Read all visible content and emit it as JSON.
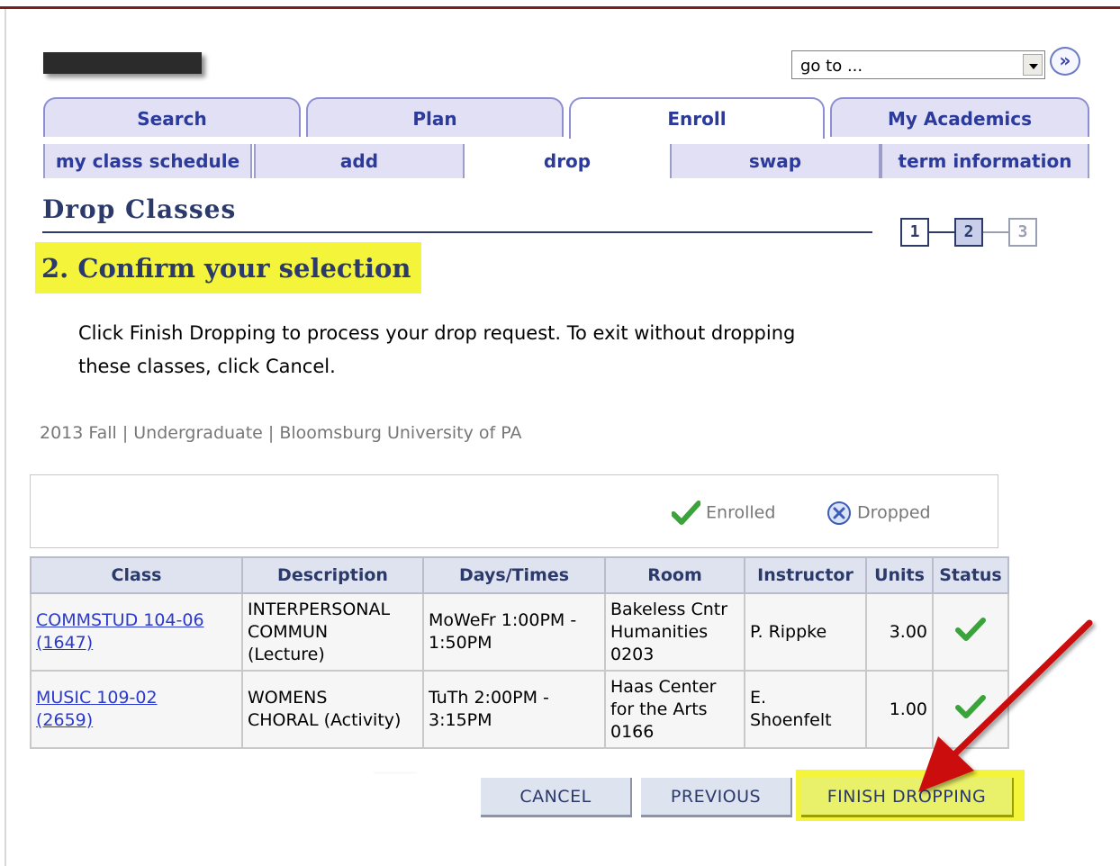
{
  "header": {
    "goto_value": "go to ..."
  },
  "tabs": [
    {
      "label": "Search"
    },
    {
      "label": "Plan"
    },
    {
      "label": "Enroll"
    },
    {
      "label": "My Academics"
    }
  ],
  "subtabs": [
    {
      "label": "my class schedule"
    },
    {
      "label": "add"
    },
    {
      "label": "drop"
    },
    {
      "label": "swap"
    },
    {
      "label": "term information"
    }
  ],
  "page": {
    "title": "Drop Classes",
    "subtitle": "2.  Confirm your selection",
    "instructions_line1": "Click Finish Dropping to process your drop request. To exit without dropping",
    "instructions_line2": "these classes, click Cancel.",
    "term_info": "2013 Fall | Undergraduate | Bloomsburg University of PA"
  },
  "stepper": {
    "steps": [
      "1",
      "2",
      "3"
    ],
    "current": 2
  },
  "legend": {
    "enrolled": "Enrolled",
    "dropped": "Dropped"
  },
  "table": {
    "headers": [
      "Class",
      "Description",
      "Days/Times",
      "Room",
      "Instructor",
      "Units",
      "Status"
    ],
    "rows": [
      {
        "class_line1": "COMMSTUD 104-06",
        "class_line2": "(1647)",
        "desc_line1": "INTERPERSONAL",
        "desc_line2": "COMMUN",
        "desc_line3": "(Lecture)",
        "days_line1": "MoWeFr 1:00PM -",
        "days_line2": "1:50PM",
        "room_line1": "Bakeless Cntr",
        "room_line2": "Humanities",
        "room_line3": "0203",
        "instructor_line1": "P. Rippke",
        "instructor_line2": "",
        "units": "3.00",
        "status": "enrolled"
      },
      {
        "class_line1": "MUSIC 109-02",
        "class_line2": "(2659)",
        "desc_line1": "WOMENS",
        "desc_line2": "CHORAL (Activity)",
        "desc_line3": "",
        "days_line1": "TuTh 2:00PM -",
        "days_line2": "3:15PM",
        "room_line1": "Haas Center",
        "room_line2": "for the Arts",
        "room_line3": "0166",
        "instructor_line1": "E.",
        "instructor_line2": "Shoenfelt",
        "units": "1.00",
        "status": "enrolled"
      }
    ]
  },
  "buttons": {
    "cancel": "CANCEL",
    "previous": "PREVIOUS",
    "finish": "FINISH DROPPING"
  },
  "colors": {
    "accent_blue": "#2b3a6b",
    "link_blue": "#2b3acd",
    "highlight_yellow": "#f4f43a",
    "annotation_arrow": "#cc1111",
    "check_green": "#3aa33a"
  }
}
